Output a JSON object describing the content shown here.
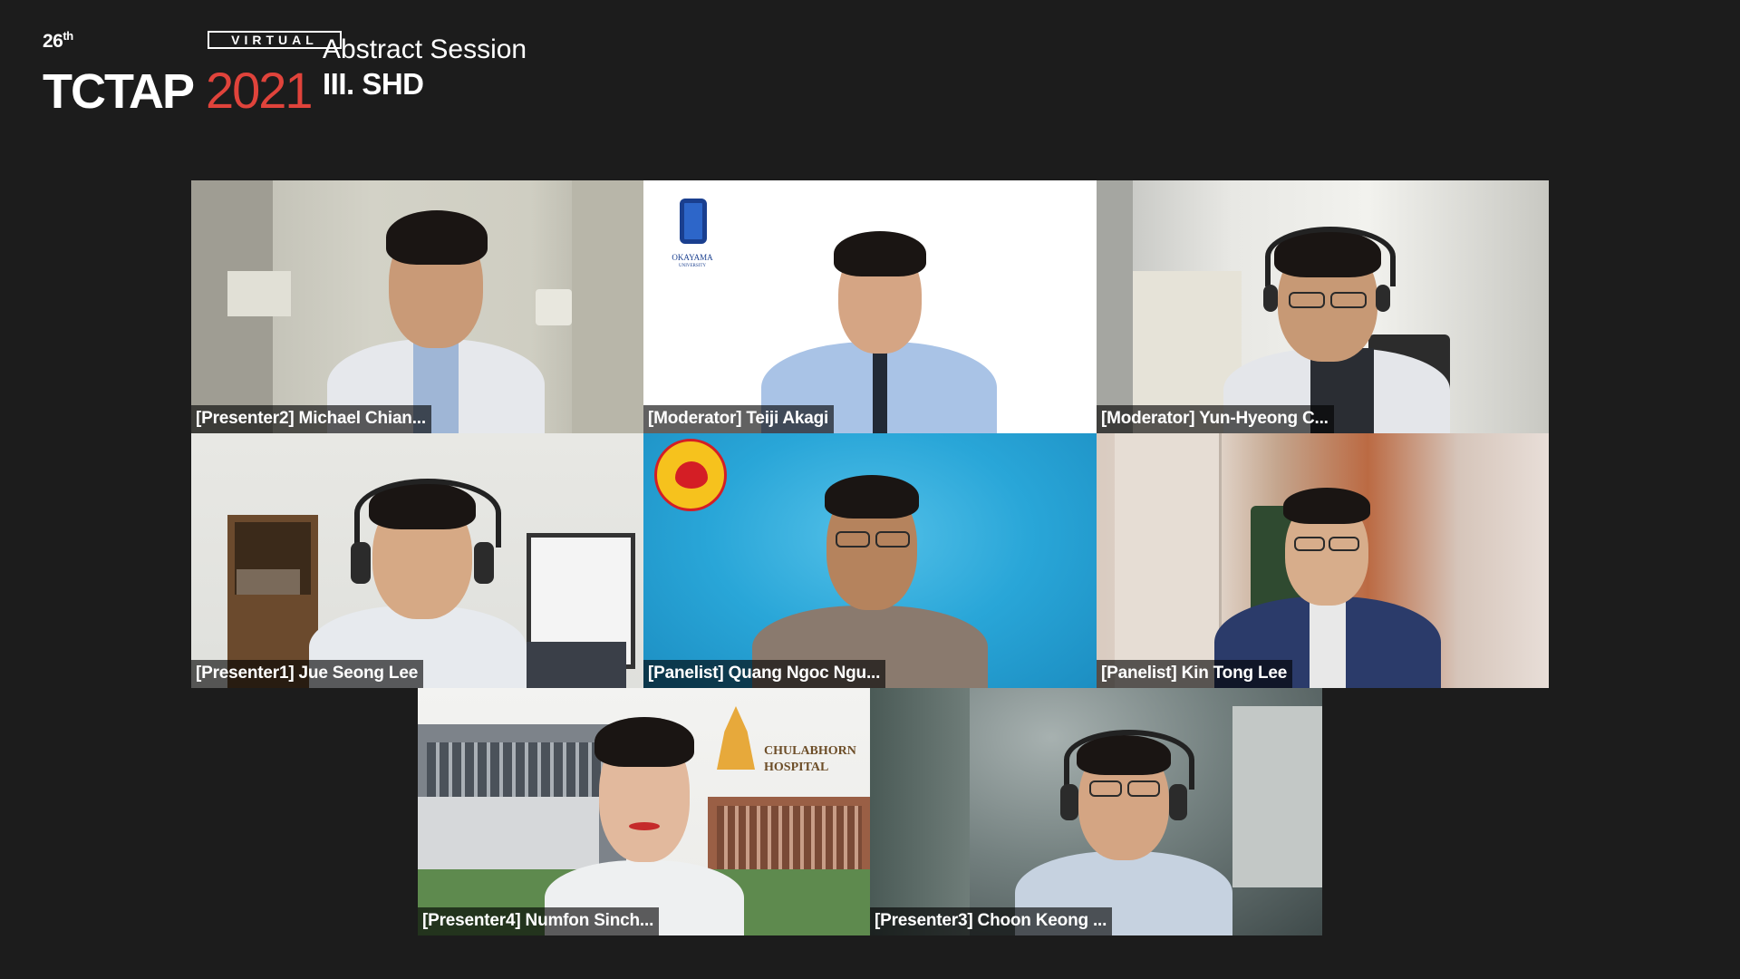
{
  "header": {
    "edition": "26",
    "edition_suffix": "th",
    "brand": "TCTAP",
    "year": "2021",
    "virtual_label": "VIRTUAL",
    "session_type": "Abstract Session",
    "track": "III. SHD"
  },
  "tiles": [
    {
      "name": "[Presenter2] Michael Chian..."
    },
    {
      "name": "[Moderator] Teiji Akagi",
      "logo_text": "OKAYAMA",
      "logo_subtext": "UNIVERSITY"
    },
    {
      "name": "[Moderator] Yun-Hyeong C..."
    },
    {
      "name": "[Presenter1] Jue Seong Lee"
    },
    {
      "name": "[Panelist] Quang Ngoc Ngu..."
    },
    {
      "name": "[Panelist] Kin Tong Lee"
    },
    {
      "name": "[Presenter4] Numfon Sinch...",
      "logo_text": "CHULABHORN",
      "logo_subtext": "HOSPITAL"
    },
    {
      "name": "[Presenter3] Choon Keong ..."
    }
  ],
  "colors": {
    "background": "#1c1c1c",
    "accent_year": "#e0433b",
    "name_tag_bg": "#000000"
  }
}
